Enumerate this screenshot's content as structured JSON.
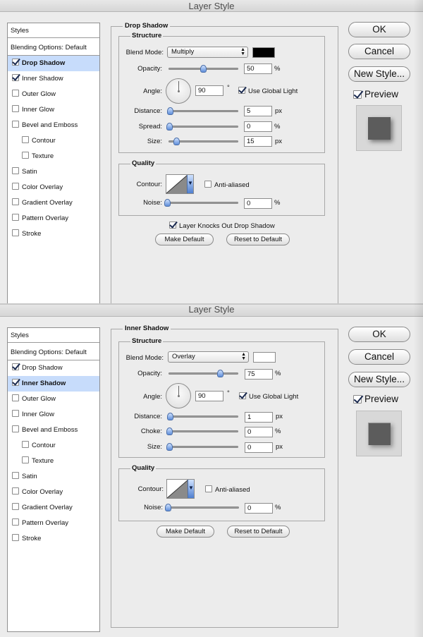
{
  "dialog1": {
    "title": "Layer Style",
    "styles_header": "Styles",
    "blending_options": "Blending Options: Default",
    "style_items": [
      {
        "label": "Drop Shadow",
        "checked": true,
        "selected": true,
        "sub": false
      },
      {
        "label": "Inner Shadow",
        "checked": true,
        "selected": false,
        "sub": false
      },
      {
        "label": "Outer Glow",
        "checked": false,
        "selected": false,
        "sub": false
      },
      {
        "label": "Inner Glow",
        "checked": false,
        "selected": false,
        "sub": false
      },
      {
        "label": "Bevel and Emboss",
        "checked": false,
        "selected": false,
        "sub": false
      },
      {
        "label": "Contour",
        "checked": false,
        "selected": false,
        "sub": true
      },
      {
        "label": "Texture",
        "checked": false,
        "selected": false,
        "sub": true
      },
      {
        "label": "Satin",
        "checked": false,
        "selected": false,
        "sub": false
      },
      {
        "label": "Color Overlay",
        "checked": false,
        "selected": false,
        "sub": false
      },
      {
        "label": "Gradient Overlay",
        "checked": false,
        "selected": false,
        "sub": false
      },
      {
        "label": "Pattern Overlay",
        "checked": false,
        "selected": false,
        "sub": false
      },
      {
        "label": "Stroke",
        "checked": false,
        "selected": false,
        "sub": false
      }
    ],
    "section_title": "Drop Shadow",
    "structure_title": "Structure",
    "blend_mode_label": "Blend Mode:",
    "blend_mode_value": "Multiply",
    "blend_color": "#000000",
    "opacity_label": "Opacity:",
    "opacity_value": "50",
    "opacity_unit": "%",
    "opacity_fraction": 0.5,
    "angle_label": "Angle:",
    "angle_value": "90",
    "angle_unit": "°",
    "global_light_label": "Use Global Light",
    "distance_label": "Distance:",
    "distance_value": "5",
    "distance_unit": "px",
    "spread_label": "Spread:",
    "spread_value": "0",
    "spread_unit": "%",
    "size_label": "Size:",
    "size_value": "15",
    "size_unit": "px",
    "quality_title": "Quality",
    "contour_label": "Contour:",
    "anti_aliased_label": "Anti-aliased",
    "noise_label": "Noise:",
    "noise_value": "0",
    "noise_unit": "%",
    "knockout_label": "Layer Knocks Out Drop Shadow",
    "make_default": "Make Default",
    "reset_default": "Reset to Default",
    "ok": "OK",
    "cancel": "Cancel",
    "new_style": "New Style...",
    "preview": "Preview"
  },
  "dialog2": {
    "title": "Layer Style",
    "styles_header": "Styles",
    "blending_options": "Blending Options: Default",
    "style_items": [
      {
        "label": "Drop Shadow",
        "checked": true,
        "selected": false,
        "sub": false
      },
      {
        "label": "Inner Shadow",
        "checked": true,
        "selected": true,
        "sub": false
      },
      {
        "label": "Outer Glow",
        "checked": false,
        "selected": false,
        "sub": false
      },
      {
        "label": "Inner Glow",
        "checked": false,
        "selected": false,
        "sub": false
      },
      {
        "label": "Bevel and Emboss",
        "checked": false,
        "selected": false,
        "sub": false
      },
      {
        "label": "Contour",
        "checked": false,
        "selected": false,
        "sub": true
      },
      {
        "label": "Texture",
        "checked": false,
        "selected": false,
        "sub": true
      },
      {
        "label": "Satin",
        "checked": false,
        "selected": false,
        "sub": false
      },
      {
        "label": "Color Overlay",
        "checked": false,
        "selected": false,
        "sub": false
      },
      {
        "label": "Gradient Overlay",
        "checked": false,
        "selected": false,
        "sub": false
      },
      {
        "label": "Pattern Overlay",
        "checked": false,
        "selected": false,
        "sub": false
      },
      {
        "label": "Stroke",
        "checked": false,
        "selected": false,
        "sub": false
      }
    ],
    "section_title": "Inner Shadow",
    "structure_title": "Structure",
    "blend_mode_label": "Blend Mode:",
    "blend_mode_value": "Overlay",
    "blend_color": "#ffffff",
    "opacity_label": "Opacity:",
    "opacity_value": "75",
    "opacity_unit": "%",
    "opacity_fraction": 0.75,
    "angle_label": "Angle:",
    "angle_value": "90",
    "angle_unit": "°",
    "global_light_label": "Use Global Light",
    "distance_label": "Distance:",
    "distance_value": "1",
    "distance_unit": "px",
    "choke_label": "Choke:",
    "choke_value": "0",
    "choke_unit": "%",
    "size_label": "Size:",
    "size_value": "0",
    "size_unit": "px",
    "quality_title": "Quality",
    "contour_label": "Contour:",
    "anti_aliased_label": "Anti-aliased",
    "noise_label": "Noise:",
    "noise_value": "0",
    "noise_unit": "%",
    "make_default": "Make Default",
    "reset_default": "Reset to Default",
    "ok": "OK",
    "cancel": "Cancel",
    "new_style": "New Style...",
    "preview": "Preview"
  }
}
